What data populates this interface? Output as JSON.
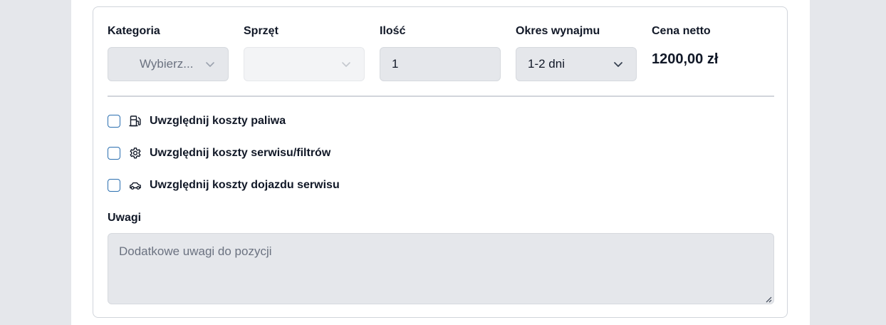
{
  "form": {
    "fields": {
      "kategoria": {
        "label": "Kategoria",
        "value": "Wybierz..."
      },
      "sprzet": {
        "label": "Sprzęt",
        "value": ""
      },
      "ilosc": {
        "label": "Ilość",
        "value": "1"
      },
      "okres": {
        "label": "Okres wynajmu",
        "value": "1-2 dni"
      },
      "cena": {
        "label": "Cena netto",
        "value": "1200,00 zł"
      }
    },
    "options": [
      {
        "label": "Uwzględnij koszty paliwa",
        "icon": "fuel-pump-icon",
        "checked": false
      },
      {
        "label": "Uwzględnij koszty serwisu/filtrów",
        "icon": "gear-icon",
        "checked": false
      },
      {
        "label": "Uwzględnij koszty dojazdu serwisu",
        "icon": "car-icon",
        "checked": false
      }
    ],
    "notes": {
      "label": "Uwagi",
      "placeholder": "Dodatkowe uwagi do pozycji",
      "value": ""
    }
  },
  "colors": {
    "background": "#e5e7eb",
    "card_border": "#d1d5db",
    "input_bg": "#e5e7eb",
    "disabled_bg": "#f3f4f6",
    "checkbox_border": "#2b6fb0",
    "text": "#111827",
    "muted_text": "#6b7280"
  }
}
